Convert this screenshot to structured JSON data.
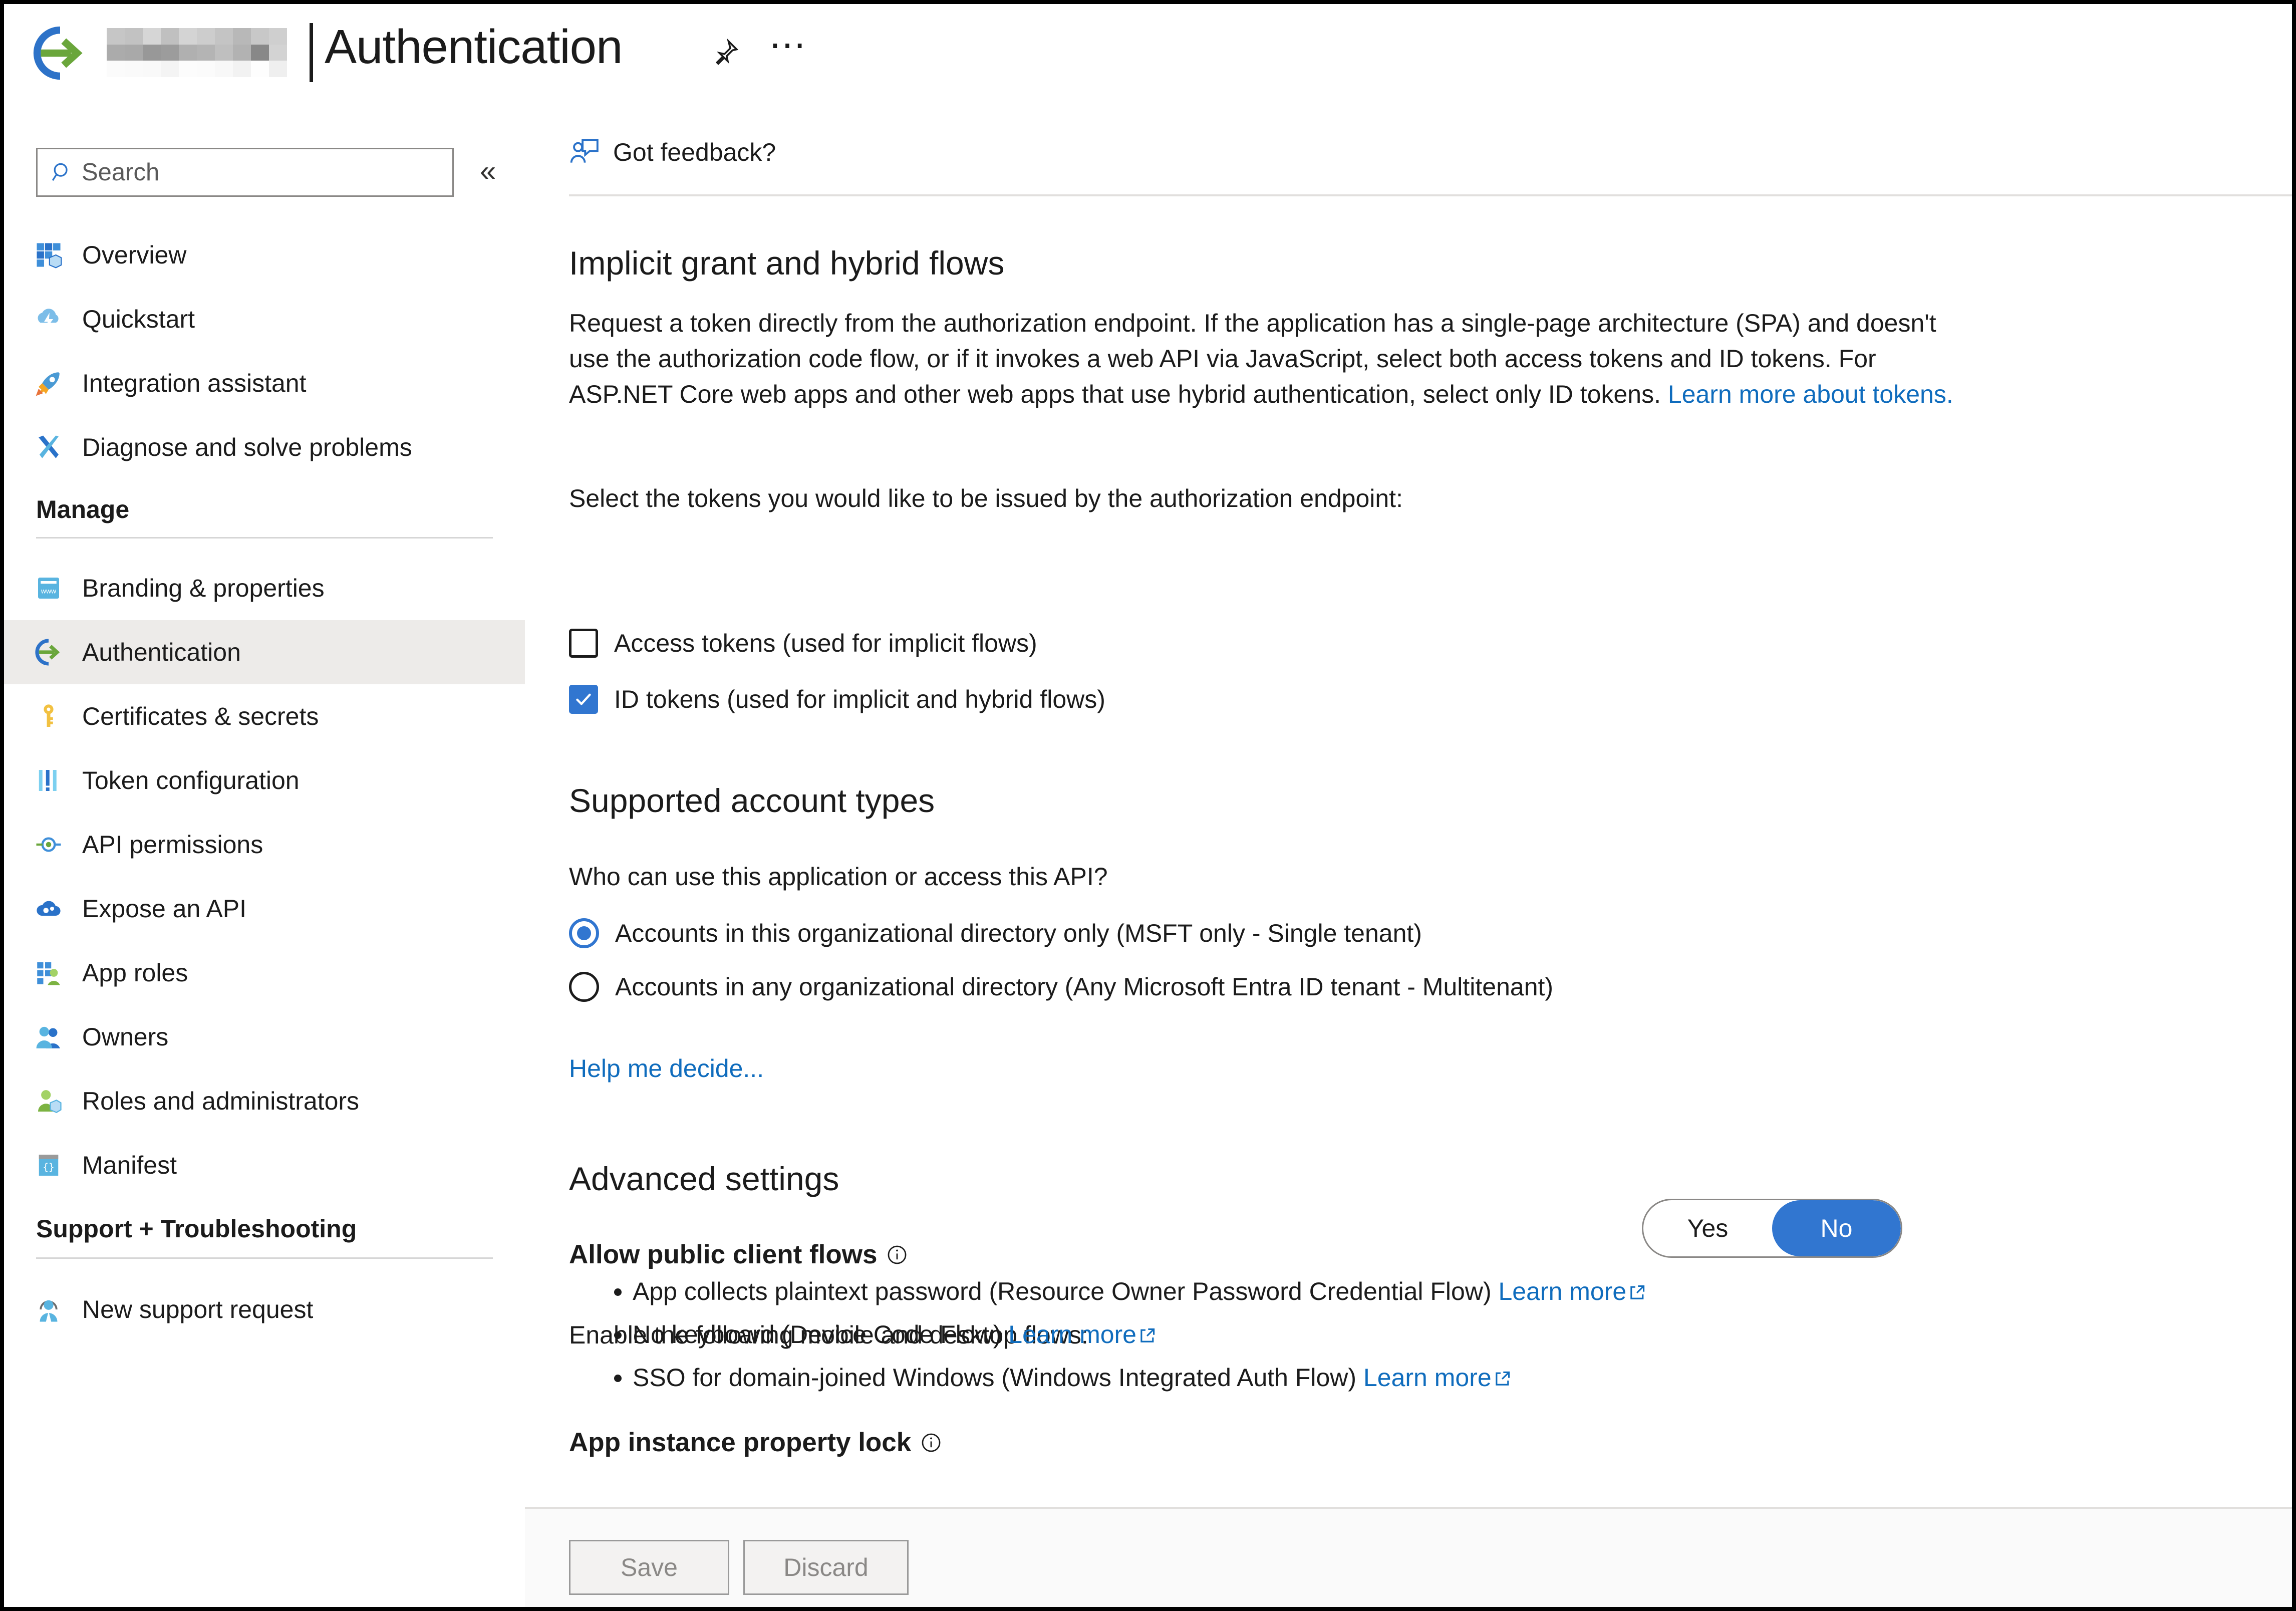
{
  "header": {
    "app_icon": "authentication-icon",
    "app_name_redacted": "",
    "separator": "|",
    "title": "Authentication",
    "pin_icon": "pin-icon",
    "more_icon": "ellipsis-icon"
  },
  "sidebar": {
    "search": {
      "placeholder": "Search",
      "icon": "search-icon"
    },
    "collapse_icon": "chevron-double-left-icon",
    "top_items": [
      {
        "label": "Overview",
        "icon": "overview-icon"
      },
      {
        "label": "Quickstart",
        "icon": "quickstart-icon"
      },
      {
        "label": "Integration assistant",
        "icon": "rocket-icon"
      },
      {
        "label": "Diagnose and solve problems",
        "icon": "wrench-icon"
      }
    ],
    "manage_group": "Manage",
    "manage_items": [
      {
        "label": "Branding & properties",
        "icon": "branding-icon",
        "selected": false
      },
      {
        "label": "Authentication",
        "icon": "authentication-icon",
        "selected": true
      },
      {
        "label": "Certificates & secrets",
        "icon": "key-icon",
        "selected": false
      },
      {
        "label": "Token configuration",
        "icon": "token-icon",
        "selected": false
      },
      {
        "label": "API permissions",
        "icon": "api-permissions-icon",
        "selected": false
      },
      {
        "label": "Expose an API",
        "icon": "expose-api-icon",
        "selected": false
      },
      {
        "label": "App roles",
        "icon": "app-roles-icon",
        "selected": false
      },
      {
        "label": "Owners",
        "icon": "owners-icon",
        "selected": false
      },
      {
        "label": "Roles and administrators",
        "icon": "roles-admins-icon",
        "selected": false
      },
      {
        "label": "Manifest",
        "icon": "manifest-icon",
        "selected": false
      }
    ],
    "support_group": "Support + Troubleshooting",
    "support_items": [
      {
        "label": "New support request",
        "icon": "support-agent-icon"
      }
    ]
  },
  "main": {
    "feedback": {
      "label": "Got feedback?",
      "icon": "feedback-icon"
    },
    "implicit": {
      "heading": "Implicit grant and hybrid flows",
      "paragraph": "Request a token directly from the authorization endpoint. If the application has a single-page architecture (SPA) and doesn't use the authorization code flow, or if it invokes a web API via JavaScript, select both access tokens and ID tokens. For ASP.NET Core web apps and other web apps that use hybrid authentication, select only ID tokens. ",
      "paragraph_link": "Learn more about tokens.",
      "select_prompt": "Select the tokens you would like to be issued by the authorization endpoint:",
      "checkboxes": [
        {
          "label": "Access tokens (used for implicit flows)",
          "checked": false
        },
        {
          "label": "ID tokens (used for implicit and hybrid flows)",
          "checked": true
        }
      ]
    },
    "account_types": {
      "heading": "Supported account types",
      "prompt": "Who can use this application or access this API?",
      "options": [
        {
          "label": "Accounts in this organizational directory only (MSFT only - Single tenant)",
          "selected": true
        },
        {
          "label": "Accounts in any organizational directory (Any Microsoft Entra ID tenant - Multitenant)",
          "selected": false
        }
      ],
      "help_link": "Help me decide..."
    },
    "advanced": {
      "heading": "Advanced settings",
      "public_client_label": "Allow public client flows",
      "public_client_info_icon": "info-icon",
      "enable_prompt": "Enable the following mobile and desktop flows:",
      "toggle": {
        "yes": "Yes",
        "no": "No",
        "value": "No"
      },
      "bullets": [
        {
          "text": "App collects plaintext password (Resource Owner Password Credential Flow) ",
          "link": "Learn more",
          "link_icon": "external-link-icon"
        },
        {
          "text": "No keyboard (Device Code Flow) ",
          "link": "Learn more",
          "link_icon": "external-link-icon"
        },
        {
          "text": "SSO for domain-joined Windows (Windows Integrated Auth Flow) ",
          "link": "Learn more",
          "link_icon": "external-link-icon"
        }
      ],
      "property_lock_label": "App instance property lock",
      "property_lock_info_icon": "info-icon"
    },
    "footer": {
      "save_label": "Save",
      "discard_label": "Discard"
    }
  },
  "colors": {
    "accent_blue": "#3176d0",
    "link_blue": "#0f6cbd",
    "selected_nav_bg": "#edebe9",
    "text": "#1b1b1b"
  }
}
